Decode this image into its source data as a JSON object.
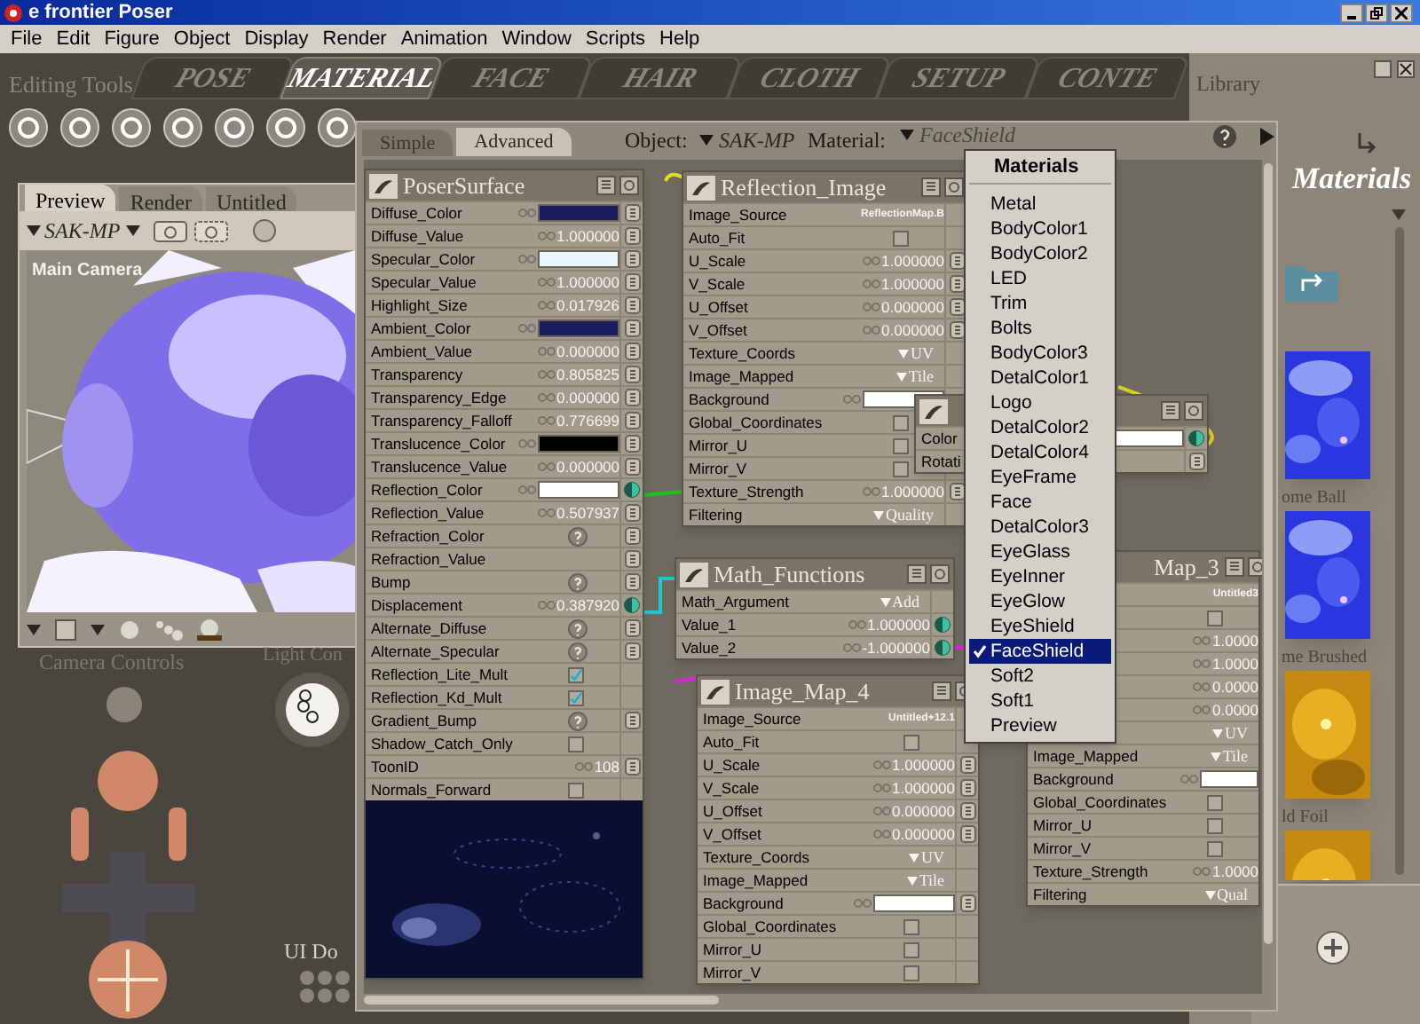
{
  "window": {
    "title": "e frontier Poser"
  },
  "menu_bar": [
    "File",
    "Edit",
    "Figure",
    "Object",
    "Display",
    "Render",
    "Animation",
    "Window",
    "Scripts",
    "Help"
  ],
  "room_tabs": [
    {
      "label": "POSE",
      "selected": false
    },
    {
      "label": "MATERIAL",
      "selected": true
    },
    {
      "label": "FACE",
      "selected": false
    },
    {
      "label": "HAIR",
      "selected": false
    },
    {
      "label": "CLOTH",
      "selected": false
    },
    {
      "label": "SETUP",
      "selected": false
    },
    {
      "label": "CONTE",
      "selected": false
    }
  ],
  "editing_tools": {
    "label": "Editing Tools"
  },
  "preview": {
    "tabs": [
      {
        "label": "Preview",
        "selected": true
      },
      {
        "label": "Render",
        "selected": false
      },
      {
        "label": "Untitled",
        "selected": false
      }
    ],
    "figure": "SAK-MP",
    "camera": "Main Camera"
  },
  "panel_labels": [
    "Camera Controls",
    "Light Con",
    "UI Do"
  ],
  "material_window": {
    "tabs": [
      {
        "label": "Simple",
        "selected": false
      },
      {
        "label": "Advanced",
        "selected": true
      }
    ],
    "object_label": "Object:",
    "object": "SAK-MP",
    "material_label": "Material:",
    "material": "FaceShield",
    "nodes": [
      {
        "title": "PoserSurface",
        "rows": [
          {
            "label": "Diffuse_Color",
            "kind": "color",
            "color": "#1c1c5e",
            "linked": false
          },
          {
            "label": "Diffuse_Value",
            "kind": "number",
            "value": "1.000000",
            "linked": false
          },
          {
            "label": "Specular_Color",
            "kind": "color",
            "color": "#eaf6ff",
            "linked": false
          },
          {
            "label": "Specular_Value",
            "kind": "number",
            "value": "1.000000",
            "linked": false
          },
          {
            "label": "Highlight_Size",
            "kind": "number",
            "value": "0.017926",
            "linked": false
          },
          {
            "label": "Ambient_Color",
            "kind": "color",
            "color": "#1c1c5e",
            "linked": false
          },
          {
            "label": "Ambient_Value",
            "kind": "number",
            "value": "0.000000",
            "linked": false
          },
          {
            "label": "Transparency",
            "kind": "number",
            "value": "0.805825",
            "linked": false
          },
          {
            "label": "Transparency_Edge",
            "kind": "number",
            "value": "0.000000",
            "linked": false
          },
          {
            "label": "Transparency_Falloff",
            "kind": "number",
            "value": "0.776699",
            "linked": false
          },
          {
            "label": "Translucence_Color",
            "kind": "color",
            "color": "#000000",
            "linked": false
          },
          {
            "label": "Translucence_Value",
            "kind": "number",
            "value": "0.000000",
            "linked": false
          },
          {
            "label": "Reflection_Color",
            "kind": "color",
            "color": "#ffffff",
            "linked": true
          },
          {
            "label": "Reflection_Value",
            "kind": "number",
            "value": "0.507937",
            "linked": false
          },
          {
            "label": "Refraction_Color",
            "kind": "help",
            "linked": false
          },
          {
            "label": "Refraction_Value",
            "kind": "plain",
            "linked": false
          },
          {
            "label": "Bump",
            "kind": "help",
            "linked": false
          },
          {
            "label": "Displacement",
            "kind": "number",
            "value": "0.387920",
            "linked": true
          },
          {
            "label": "Alternate_Diffuse",
            "kind": "help",
            "linked": false
          },
          {
            "label": "Alternate_Specular",
            "kind": "help",
            "linked": false
          },
          {
            "label": "Reflection_Lite_Mult",
            "kind": "check",
            "checked": true
          },
          {
            "label": "Reflection_Kd_Mult",
            "kind": "check",
            "checked": true
          },
          {
            "label": "Gradient_Bump",
            "kind": "help",
            "linked": false
          },
          {
            "label": "Shadow_Catch_Only",
            "kind": "check",
            "checked": false
          },
          {
            "label": "ToonID",
            "kind": "number",
            "value": "108",
            "linked": false
          },
          {
            "label": "Normals_Forward",
            "kind": "check",
            "checked": false
          }
        ]
      },
      {
        "title": "Reflection_Image",
        "rows": [
          {
            "label": "Image_Source",
            "kind": "source",
            "value": "ReflectionMap.B"
          },
          {
            "label": "Auto_Fit",
            "kind": "check",
            "checked": false
          },
          {
            "label": "U_Scale",
            "kind": "number",
            "value": "1.000000",
            "linked": false
          },
          {
            "label": "V_Scale",
            "kind": "number",
            "value": "1.000000",
            "linked": false
          },
          {
            "label": "U_Offset",
            "kind": "number",
            "value": "0.000000",
            "linked": false
          },
          {
            "label": "V_Offset",
            "kind": "number",
            "value": "0.000000",
            "linked": false
          },
          {
            "label": "Texture_Coords",
            "kind": "menu",
            "value": "UV"
          },
          {
            "label": "Image_Mapped",
            "kind": "menu",
            "value": "Tile"
          },
          {
            "label": "Background",
            "kind": "color",
            "color": "#ffffff"
          },
          {
            "label": "Global_Coordinates",
            "kind": "check",
            "checked": false
          },
          {
            "label": "Mirror_U",
            "kind": "check",
            "checked": false
          },
          {
            "label": "Mirror_V",
            "kind": "check",
            "checked": false
          },
          {
            "label": "Texture_Strength",
            "kind": "number",
            "value": "1.000000",
            "linked": false
          },
          {
            "label": "Filtering",
            "kind": "menu",
            "value": "Quality"
          }
        ]
      },
      {
        "rows": [
          {
            "label": "Color",
            "kind": "color",
            "color": "#ffffff",
            "linked": true
          },
          {
            "label": "Rotati",
            "kind": "plain",
            "linked": false
          }
        ]
      },
      {
        "title": "Math_Functions",
        "rows": [
          {
            "label": "Math_Argument",
            "kind": "menu",
            "value": "Add"
          },
          {
            "label": "Value_1",
            "kind": "number",
            "value": "1.000000",
            "linked": true
          },
          {
            "label": "Value_2",
            "kind": "number",
            "value": "-1.000000",
            "linked": true
          }
        ]
      },
      {
        "title": "Image_Map_4",
        "rows": [
          {
            "label": "Image_Source",
            "kind": "source",
            "value": "Untitled+12.1"
          },
          {
            "label": "Auto_Fit",
            "kind": "check",
            "checked": false
          },
          {
            "label": "U_Scale",
            "kind": "number",
            "value": "1.000000",
            "linked": false
          },
          {
            "label": "V_Scale",
            "kind": "number",
            "value": "1.000000",
            "linked": false
          },
          {
            "label": "U_Offset",
            "kind": "number",
            "value": "0.000000",
            "linked": false
          },
          {
            "label": "V_Offset",
            "kind": "number",
            "value": "0.000000",
            "linked": false
          },
          {
            "label": "Texture_Coords",
            "kind": "menu",
            "value": "UV"
          },
          {
            "label": "Image_Mapped",
            "kind": "menu",
            "value": "Tile"
          },
          {
            "label": "Background",
            "kind": "color",
            "color": "#ffffff",
            "linked": false
          },
          {
            "label": "Global_Coordinates",
            "kind": "check",
            "checked": false
          },
          {
            "label": "Mirror_U",
            "kind": "check",
            "checked": false
          },
          {
            "label": "Mirror_V",
            "kind": "check",
            "checked": false
          }
        ]
      },
      {
        "title": "Map_3",
        "rows": [
          {
            "kind": "source",
            "value": "Untitled3"
          },
          {
            "kind": "check",
            "checked": false
          },
          {
            "kind": "number",
            "value": "1.0000"
          },
          {
            "kind": "number",
            "value": "1.0000"
          },
          {
            "kind": "number",
            "value": "0.0000"
          },
          {
            "kind": "number",
            "value": "0.0000"
          },
          {
            "kind": "menu",
            "value": "UV"
          },
          {
            "label": "Image_Mapped",
            "kind": "menu",
            "value": "Tile"
          },
          {
            "label": "Background",
            "kind": "color",
            "color": "#ffffff"
          },
          {
            "label": "Global_Coordinates",
            "kind": "check",
            "checked": false
          },
          {
            "label": "Mirror_U",
            "kind": "check",
            "checked": false
          },
          {
            "label": "Mirror_V",
            "kind": "check",
            "checked": false
          },
          {
            "label": "Texture_Strength",
            "kind": "number",
            "value": "1.0000"
          },
          {
            "label": "Filtering",
            "kind": "menu",
            "value": "Qual"
          }
        ]
      }
    ]
  },
  "material_menu": {
    "title": "Materials",
    "items": [
      {
        "label": "Metal",
        "selected": false
      },
      {
        "label": "BodyColor1",
        "selected": false
      },
      {
        "label": "BodyColor2",
        "selected": false
      },
      {
        "label": "LED",
        "selected": false
      },
      {
        "label": "Trim",
        "selected": false
      },
      {
        "label": "Bolts",
        "selected": false
      },
      {
        "label": "BodyColor3",
        "selected": false
      },
      {
        "label": "DetalColor1",
        "selected": false
      },
      {
        "label": "Logo",
        "selected": false
      },
      {
        "label": "DetalColor2",
        "selected": false
      },
      {
        "label": "DetalColor4",
        "selected": false
      },
      {
        "label": "EyeFrame",
        "selected": false
      },
      {
        "label": "Face",
        "selected": false
      },
      {
        "label": "DetalColor3",
        "selected": false
      },
      {
        "label": "EyeGlass",
        "selected": false
      },
      {
        "label": "EyeInner",
        "selected": false
      },
      {
        "label": "EyeGlow",
        "selected": false
      },
      {
        "label": "EyeShield",
        "selected": false
      },
      {
        "label": "FaceShield",
        "selected": true
      },
      {
        "label": "Soft2",
        "selected": false
      },
      {
        "label": "Soft1",
        "selected": false
      },
      {
        "label": "Preview",
        "selected": false
      }
    ]
  },
  "library": {
    "title": "Library",
    "heading": "Materials",
    "items": [
      {
        "caption": "ome Ball",
        "kind": "blue"
      },
      {
        "caption": "me Brushed",
        "kind": "blue"
      },
      {
        "caption": "ld Foil",
        "kind": "gold"
      },
      {
        "kind": "gold"
      }
    ]
  }
}
